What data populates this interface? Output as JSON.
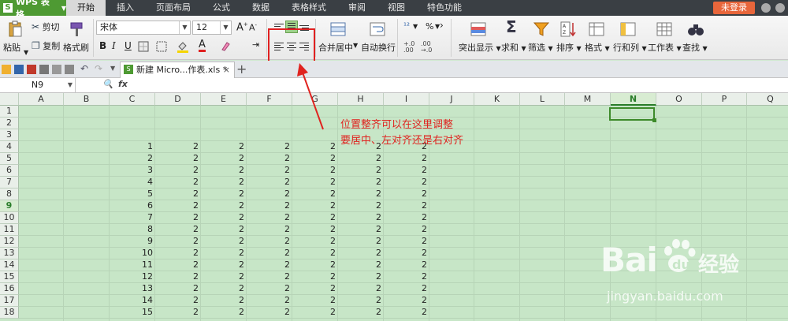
{
  "titlebar": {
    "app_name": "WPS 表格",
    "tabs": [
      "开始",
      "插入",
      "页面布局",
      "公式",
      "数据",
      "表格样式",
      "审阅",
      "视图",
      "特色功能"
    ],
    "active_tab": "开始",
    "login_label": "未登录"
  },
  "ribbon": {
    "paste": "粘贴",
    "cut": "剪切",
    "copy": "复制",
    "format_painter": "格式刷",
    "font_name": "宋体",
    "font_size": "12",
    "bold": "B",
    "italic": "I",
    "underline": "U",
    "font_color_glyph": "A",
    "merge_center": "合并居中",
    "wrap_text": "自动换行",
    "percent": "%",
    "conditional": "突出显示",
    "sum": "求和",
    "filter": "筛选",
    "sort": "排序",
    "format": "格式",
    "rows_cols": "行和列",
    "worksheet": "工作表",
    "find": "查找"
  },
  "doc_tab": {
    "filename": "新建 Micro...作表.xls *"
  },
  "formula_bar": {
    "name_box": "N9",
    "fx": "fx"
  },
  "grid": {
    "columns": [
      "A",
      "B",
      "C",
      "D",
      "E",
      "F",
      "G",
      "H",
      "I",
      "J",
      "K",
      "L",
      "M",
      "N",
      "O",
      "P",
      "Q"
    ],
    "selected_column": "N",
    "rows": [
      "1",
      "2",
      "3",
      "4",
      "5",
      "6",
      "7",
      "8",
      "9",
      "10",
      "11",
      "12",
      "13",
      "14",
      "15",
      "16",
      "17",
      "18"
    ],
    "selected_row": "9",
    "c_values": [
      "1",
      "2",
      "3",
      "4",
      "5",
      "6",
      "7",
      "8",
      "9",
      "10",
      "11",
      "12",
      "13",
      "14",
      "15"
    ],
    "fill_value": "2"
  },
  "annotation": {
    "line1": "位置整齐可以在这里调整",
    "line2": "要居中、左对齐还是右对齐",
    "color": "#e0231f"
  },
  "watermark": {
    "brand_latin": "Bai",
    "brand_tail": "du",
    "brand_cn": "经验",
    "url": "jingyan.baidu.com"
  }
}
